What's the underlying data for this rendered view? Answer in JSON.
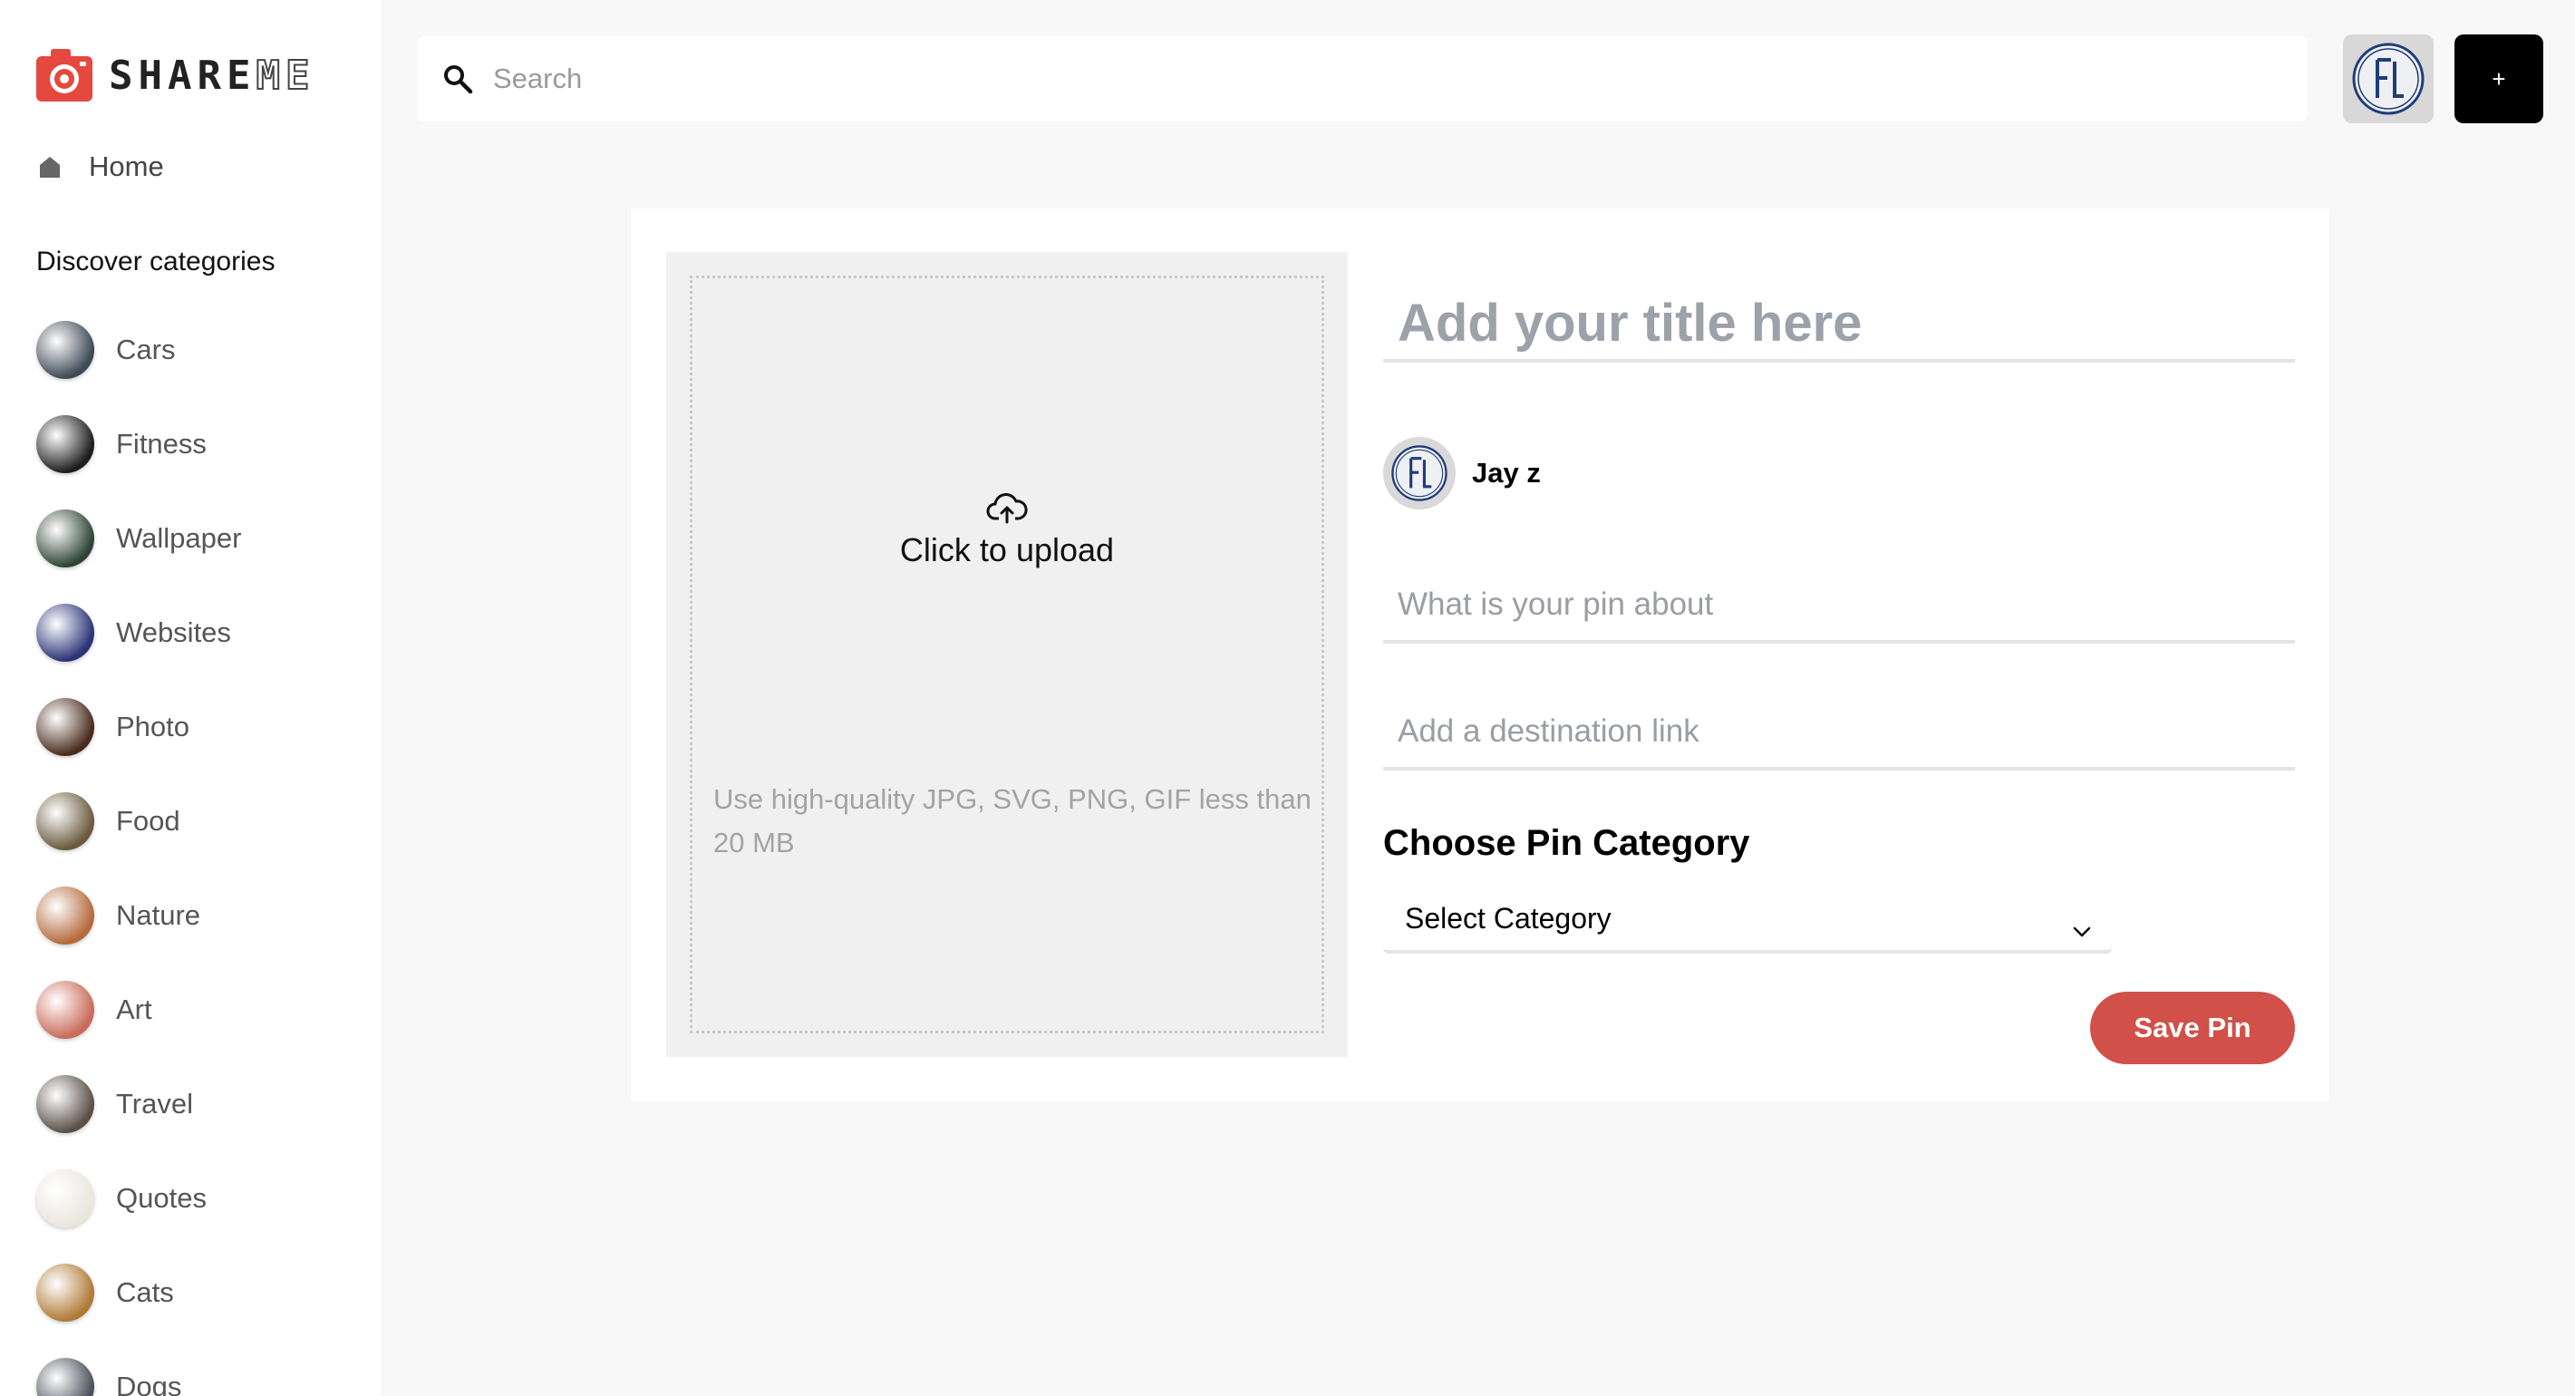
{
  "brand": {
    "name_prefix": "SHARE",
    "name_suffix": "ME",
    "accent_color": "#e5483f"
  },
  "sidebar": {
    "home_label": "Home",
    "discover_heading": "Discover categories",
    "categories": [
      {
        "label": "Cars",
        "thumb": "#3e4a56"
      },
      {
        "label": "Fitness",
        "thumb": "#1e1e1e"
      },
      {
        "label": "Wallpaper",
        "thumb": "#2e4436"
      },
      {
        "label": "Websites",
        "thumb": "#2c3477"
      },
      {
        "label": "Photo",
        "thumb": "#4a2c1e"
      },
      {
        "label": "Food",
        "thumb": "#6b5a3e"
      },
      {
        "label": "Nature",
        "thumb": "#b46a3c"
      },
      {
        "label": "Art",
        "thumb": "#c96b5a"
      },
      {
        "label": "Travel",
        "thumb": "#5a5048"
      },
      {
        "label": "Quotes",
        "thumb": "#e9e6de"
      },
      {
        "label": "Cats",
        "thumb": "#b07a36"
      },
      {
        "label": "Dogs",
        "thumb": "#4a5058"
      }
    ]
  },
  "topbar": {
    "search_placeholder": "Search",
    "add_button_label": "+"
  },
  "form": {
    "upload_label": "Click to upload",
    "upload_hint": "Use high-quality JPG, SVG, PNG, GIF less than 20 MB",
    "title_placeholder": "Add your title here",
    "user_name": "Jay z",
    "about_placeholder": "What is your pin about",
    "link_placeholder": "Add a destination link",
    "category_heading": "Choose Pin Category",
    "category_selected": "Select Category",
    "save_label": "Save Pin",
    "save_color": "#d1504a"
  }
}
